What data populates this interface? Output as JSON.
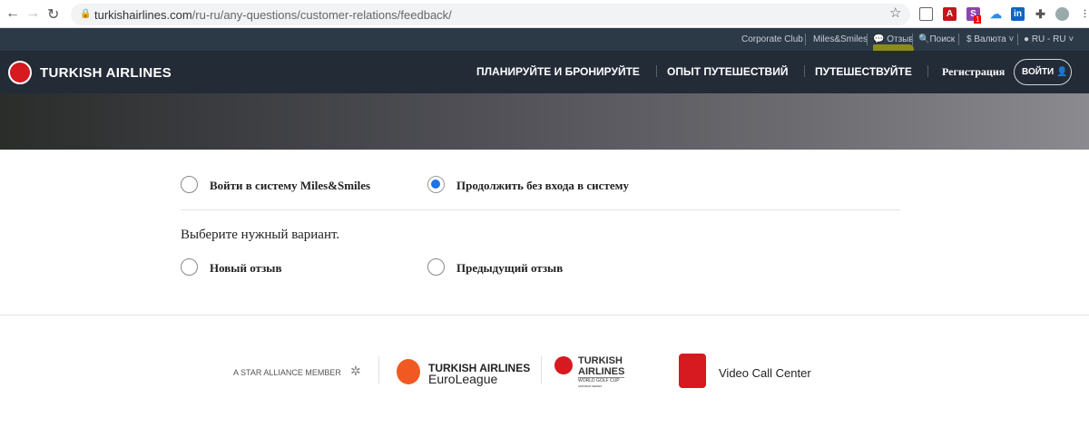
{
  "browser": {
    "url_domain": "turkishairlines.com",
    "url_path": "/ru-ru/any-questions/customer-relations/feedback/",
    "badge": "1"
  },
  "topnav": {
    "items": [
      "Corporate Club",
      "Miles&Smiles",
      "Отзыв",
      "Поиск",
      "Валюта",
      "RU - RU"
    ]
  },
  "header": {
    "brand": "TURKISH AIRLINES",
    "menu": [
      "ПЛАНИРУЙТЕ И БРОНИРУЙТЕ",
      "ОПЫТ ПУТЕШЕСТВИЙ",
      "ПУТЕШЕСТВУЙТЕ"
    ],
    "register": "Регистрация",
    "login": "ВОЙТИ"
  },
  "form": {
    "login_options": [
      {
        "label": "Войти в систему Miles&Smiles",
        "selected": false
      },
      {
        "label": "Продолжить без входа в систему",
        "selected": true
      }
    ],
    "prompt": "Выберите нужный вариант.",
    "feedback_options": [
      {
        "label": "Новый отзыв",
        "selected": false
      },
      {
        "label": "Предыдущий отзыв",
        "selected": false
      }
    ]
  },
  "footer": {
    "star_alliance": "A STAR ALLIANCE MEMBER",
    "euroleague_1": "TURKISH AIRLINES",
    "euroleague_2": "EuroLeague",
    "golf_1": "TURKISH",
    "golf_2": "AIRLINES",
    "golf_3": "WORLD GOLF CUP",
    "golf_4": "AMATEUR SERIES",
    "video": "Video Call Center"
  },
  "colors": {
    "accent": "#1a73e8",
    "brand_red": "#d71920",
    "euroleague": "#f05a22"
  }
}
